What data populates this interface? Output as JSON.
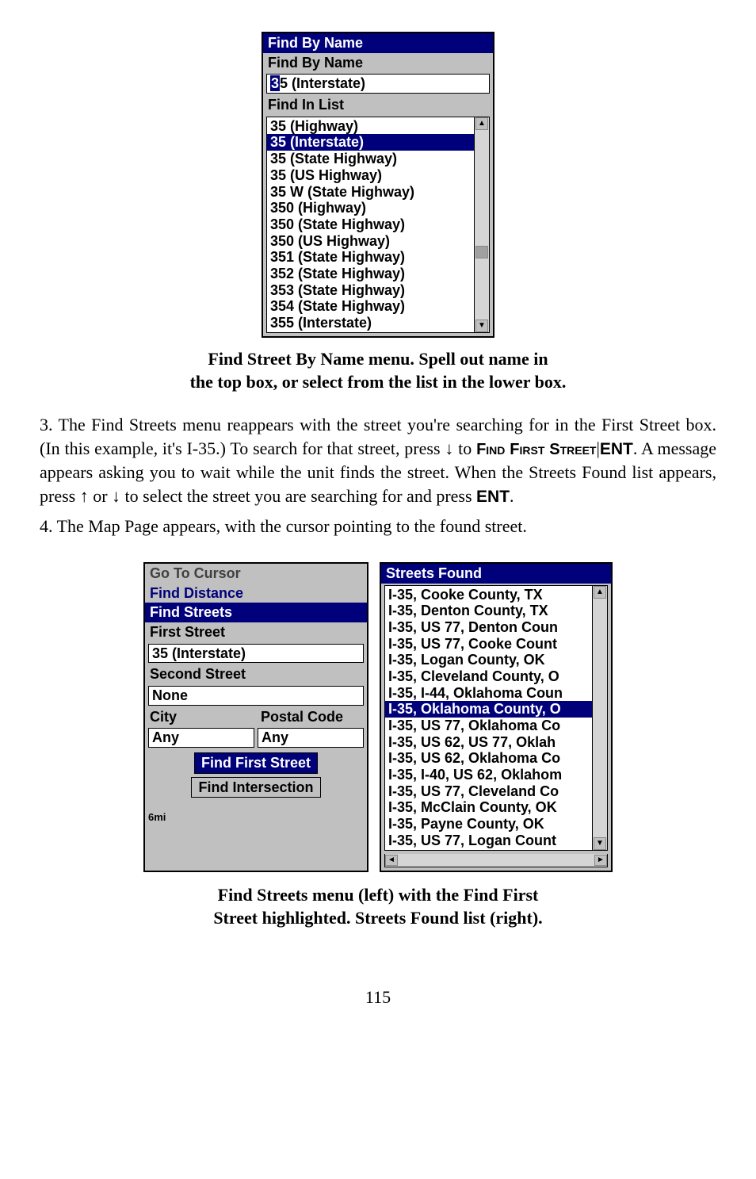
{
  "fig1": {
    "title_selected": "Find By Name",
    "subtitle": "Find By Name",
    "input_prefix": "3",
    "input_rest": "5 (Interstate)",
    "list_label": "Find In List",
    "items": [
      "35 (Highway)",
      "35 (Interstate)",
      "35 (State Highway)",
      "35 (US Highway)",
      "35 W (State Highway)",
      "350 (Highway)",
      "350 (State Highway)",
      "350 (US Highway)",
      "351 (State Highway)",
      "352 (State Highway)",
      "353 (State Highway)",
      "354 (State Highway)",
      "355 (Interstate)"
    ],
    "selected_index": 1
  },
  "caption1_l1": "Find Street By Name menu. Spell out name in",
  "caption1_l2": "the top box, or select from the list in the lower box.",
  "para3_a": "3. The Find Streets menu reappears with the street you're searching for in the First Street box. (In this example, it's I-35.) To search for that street, press ↓ to ",
  "para3_b": "Find First Street",
  "para3_c": "|",
  "para3_d": "ENT",
  "para3_e": ". A message appears asking you to wait while the unit finds the street. When the Streets Found list appears, press ↑ or ↓ to select the street you are searching for and press ",
  "para3_f": "ENT",
  "para3_g": ".",
  "para4": "4. The Map Page appears, with the cursor pointing to the found street.",
  "fig2_left": {
    "menu_dim1": "Go To Cursor",
    "menu_dim2": "Find Distance",
    "title": "Find Streets",
    "lbl_first": "First Street",
    "val_first": "35 (Interstate)",
    "lbl_second": "Second Street",
    "val_second": "None",
    "lbl_city": "City",
    "lbl_postal": "Postal Code",
    "val_city": "Any",
    "val_postal": "Any",
    "btn_find_first": "Find First Street",
    "btn_find_int": "Find Intersection",
    "scale": "6mi"
  },
  "fig2_right": {
    "title": "Streets Found",
    "items": [
      "I-35, Cooke County, TX",
      "I-35, Denton County, TX",
      "I-35, US 77, Denton Coun",
      "I-35, US 77, Cooke Count",
      "I-35, Logan County, OK",
      "I-35, Cleveland County, O",
      "I-35, I-44, Oklahoma Coun",
      "I-35, Oklahoma County, O",
      "I-35, US 77, Oklahoma Co",
      "I-35, US 62, US 77, Oklah",
      "I-35, US 62, Oklahoma Co",
      "I-35, I-40, US 62, Oklahom",
      "I-35, US 77, Cleveland Co",
      "I-35, McClain County, OK",
      "I-35, Payne County, OK",
      "I-35, US 77, Logan Count"
    ],
    "selected_index": 7
  },
  "caption2_l1": "Find Streets menu (left) with the Find First",
  "caption2_l2": "Street highlighted. Streets Found list (right).",
  "page_number": "115"
}
